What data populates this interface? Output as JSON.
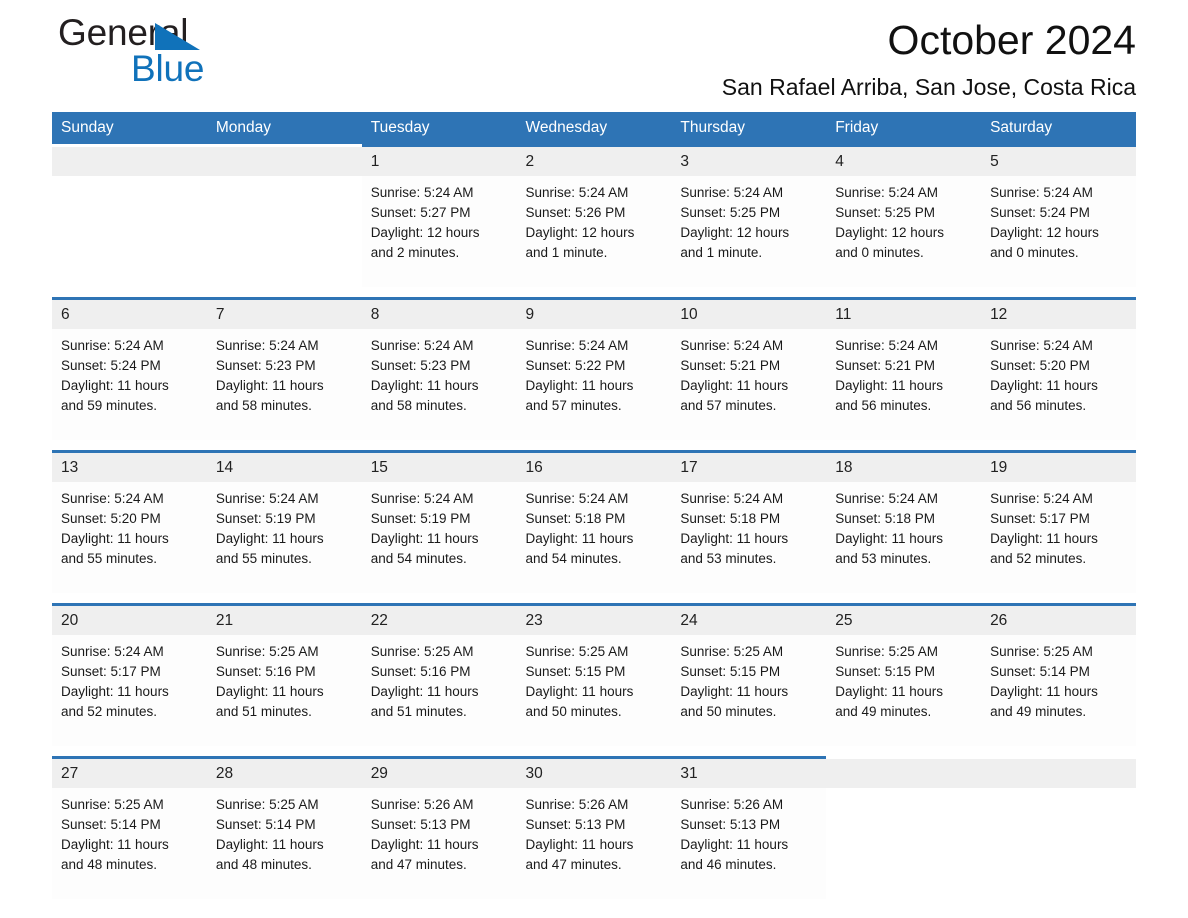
{
  "brand": {
    "word_one": "General",
    "word_two": "Blue",
    "triangle_icon": "triangle-icon",
    "color_black": "#231f20",
    "color_blue": "#1072ba"
  },
  "header": {
    "title": "October 2024",
    "subtitle": "San Rafael Arriba, San Jose, Costa Rica"
  },
  "theme": {
    "header_blue": "#2e74b5",
    "daynum_gray": "#efefef",
    "cell_white": "#fdfdfd"
  },
  "calendar": {
    "weekday_headers": [
      "Sunday",
      "Monday",
      "Tuesday",
      "Wednesday",
      "Thursday",
      "Friday",
      "Saturday"
    ],
    "weeks": [
      [
        {
          "day": "",
          "lines": []
        },
        {
          "day": "",
          "lines": []
        },
        {
          "day": "1",
          "lines": [
            "Sunrise: 5:24 AM",
            "Sunset: 5:27 PM",
            "Daylight: 12 hours",
            "and 2 minutes."
          ]
        },
        {
          "day": "2",
          "lines": [
            "Sunrise: 5:24 AM",
            "Sunset: 5:26 PM",
            "Daylight: 12 hours",
            "and 1 minute."
          ]
        },
        {
          "day": "3",
          "lines": [
            "Sunrise: 5:24 AM",
            "Sunset: 5:25 PM",
            "Daylight: 12 hours",
            "and 1 minute."
          ]
        },
        {
          "day": "4",
          "lines": [
            "Sunrise: 5:24 AM",
            "Sunset: 5:25 PM",
            "Daylight: 12 hours",
            "and 0 minutes."
          ]
        },
        {
          "day": "5",
          "lines": [
            "Sunrise: 5:24 AM",
            "Sunset: 5:24 PM",
            "Daylight: 12 hours",
            "and 0 minutes."
          ]
        }
      ],
      [
        {
          "day": "6",
          "lines": [
            "Sunrise: 5:24 AM",
            "Sunset: 5:24 PM",
            "Daylight: 11 hours",
            "and 59 minutes."
          ]
        },
        {
          "day": "7",
          "lines": [
            "Sunrise: 5:24 AM",
            "Sunset: 5:23 PM",
            "Daylight: 11 hours",
            "and 58 minutes."
          ]
        },
        {
          "day": "8",
          "lines": [
            "Sunrise: 5:24 AM",
            "Sunset: 5:23 PM",
            "Daylight: 11 hours",
            "and 58 minutes."
          ]
        },
        {
          "day": "9",
          "lines": [
            "Sunrise: 5:24 AM",
            "Sunset: 5:22 PM",
            "Daylight: 11 hours",
            "and 57 minutes."
          ]
        },
        {
          "day": "10",
          "lines": [
            "Sunrise: 5:24 AM",
            "Sunset: 5:21 PM",
            "Daylight: 11 hours",
            "and 57 minutes."
          ]
        },
        {
          "day": "11",
          "lines": [
            "Sunrise: 5:24 AM",
            "Sunset: 5:21 PM",
            "Daylight: 11 hours",
            "and 56 minutes."
          ]
        },
        {
          "day": "12",
          "lines": [
            "Sunrise: 5:24 AM",
            "Sunset: 5:20 PM",
            "Daylight: 11 hours",
            "and 56 minutes."
          ]
        }
      ],
      [
        {
          "day": "13",
          "lines": [
            "Sunrise: 5:24 AM",
            "Sunset: 5:20 PM",
            "Daylight: 11 hours",
            "and 55 minutes."
          ]
        },
        {
          "day": "14",
          "lines": [
            "Sunrise: 5:24 AM",
            "Sunset: 5:19 PM",
            "Daylight: 11 hours",
            "and 55 minutes."
          ]
        },
        {
          "day": "15",
          "lines": [
            "Sunrise: 5:24 AM",
            "Sunset: 5:19 PM",
            "Daylight: 11 hours",
            "and 54 minutes."
          ]
        },
        {
          "day": "16",
          "lines": [
            "Sunrise: 5:24 AM",
            "Sunset: 5:18 PM",
            "Daylight: 11 hours",
            "and 54 minutes."
          ]
        },
        {
          "day": "17",
          "lines": [
            "Sunrise: 5:24 AM",
            "Sunset: 5:18 PM",
            "Daylight: 11 hours",
            "and 53 minutes."
          ]
        },
        {
          "day": "18",
          "lines": [
            "Sunrise: 5:24 AM",
            "Sunset: 5:18 PM",
            "Daylight: 11 hours",
            "and 53 minutes."
          ]
        },
        {
          "day": "19",
          "lines": [
            "Sunrise: 5:24 AM",
            "Sunset: 5:17 PM",
            "Daylight: 11 hours",
            "and 52 minutes."
          ]
        }
      ],
      [
        {
          "day": "20",
          "lines": [
            "Sunrise: 5:24 AM",
            "Sunset: 5:17 PM",
            "Daylight: 11 hours",
            "and 52 minutes."
          ]
        },
        {
          "day": "21",
          "lines": [
            "Sunrise: 5:25 AM",
            "Sunset: 5:16 PM",
            "Daylight: 11 hours",
            "and 51 minutes."
          ]
        },
        {
          "day": "22",
          "lines": [
            "Sunrise: 5:25 AM",
            "Sunset: 5:16 PM",
            "Daylight: 11 hours",
            "and 51 minutes."
          ]
        },
        {
          "day": "23",
          "lines": [
            "Sunrise: 5:25 AM",
            "Sunset: 5:15 PM",
            "Daylight: 11 hours",
            "and 50 minutes."
          ]
        },
        {
          "day": "24",
          "lines": [
            "Sunrise: 5:25 AM",
            "Sunset: 5:15 PM",
            "Daylight: 11 hours",
            "and 50 minutes."
          ]
        },
        {
          "day": "25",
          "lines": [
            "Sunrise: 5:25 AM",
            "Sunset: 5:15 PM",
            "Daylight: 11 hours",
            "and 49 minutes."
          ]
        },
        {
          "day": "26",
          "lines": [
            "Sunrise: 5:25 AM",
            "Sunset: 5:14 PM",
            "Daylight: 11 hours",
            "and 49 minutes."
          ]
        }
      ],
      [
        {
          "day": "27",
          "lines": [
            "Sunrise: 5:25 AM",
            "Sunset: 5:14 PM",
            "Daylight: 11 hours",
            "and 48 minutes."
          ]
        },
        {
          "day": "28",
          "lines": [
            "Sunrise: 5:25 AM",
            "Sunset: 5:14 PM",
            "Daylight: 11 hours",
            "and 48 minutes."
          ]
        },
        {
          "day": "29",
          "lines": [
            "Sunrise: 5:26 AM",
            "Sunset: 5:13 PM",
            "Daylight: 11 hours",
            "and 47 minutes."
          ]
        },
        {
          "day": "30",
          "lines": [
            "Sunrise: 5:26 AM",
            "Sunset: 5:13 PM",
            "Daylight: 11 hours",
            "and 47 minutes."
          ]
        },
        {
          "day": "31",
          "lines": [
            "Sunrise: 5:26 AM",
            "Sunset: 5:13 PM",
            "Daylight: 11 hours",
            "and 46 minutes."
          ]
        },
        {
          "day": "",
          "lines": []
        },
        {
          "day": "",
          "lines": []
        }
      ]
    ]
  }
}
